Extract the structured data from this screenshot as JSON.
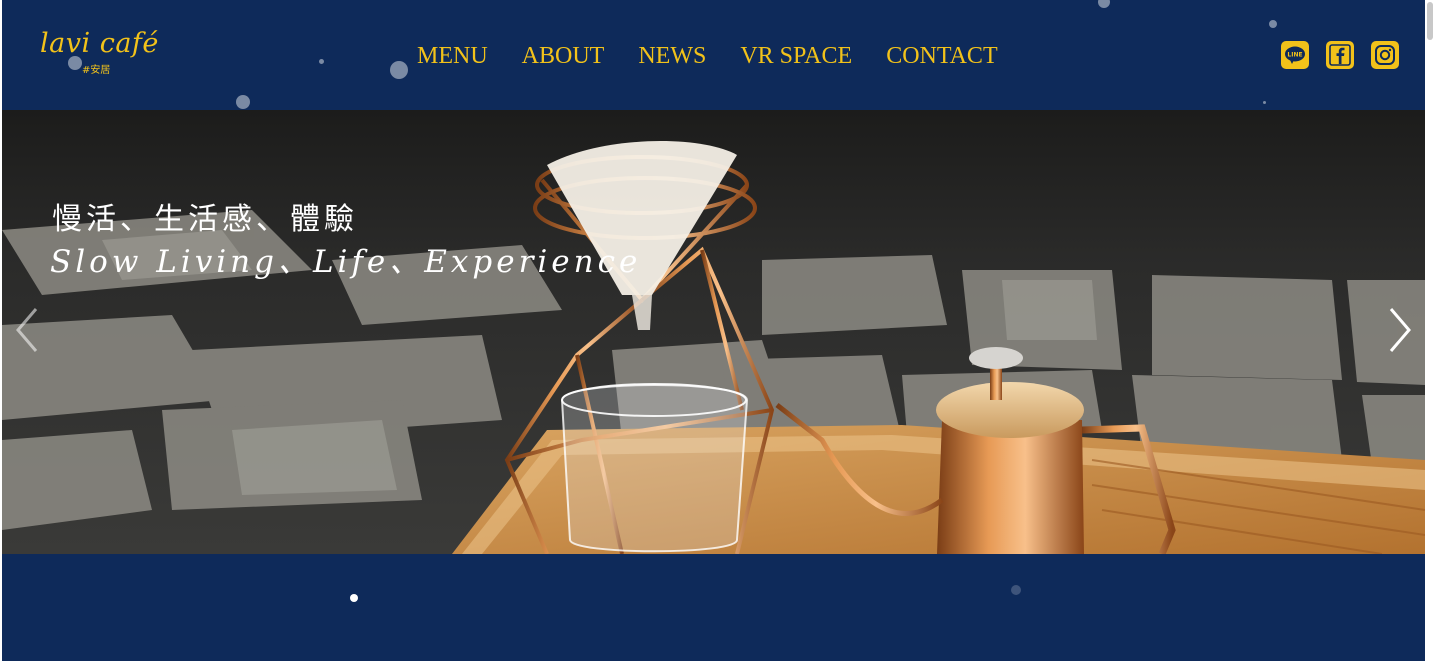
{
  "brand": {
    "logo_text": "lavi café",
    "logo_sub": "#安居",
    "color_primary": "#0e2a5a",
    "color_accent": "#f2c21a"
  },
  "nav": {
    "items": [
      {
        "label": "MENU"
      },
      {
        "label": "ABOUT"
      },
      {
        "label": "NEWS"
      },
      {
        "label": "VR SPACE"
      },
      {
        "label": "CONTACT"
      }
    ]
  },
  "social": {
    "icons": [
      "line-icon",
      "facebook-icon",
      "instagram-icon"
    ],
    "line_label": "LINE"
  },
  "hero": {
    "headline_zh": "慢活、生活感、體驗",
    "headline_en": "Slow Living、Life、Experience"
  },
  "carousel": {
    "prev_icon": "chevron-left-icon",
    "next_icon": "chevron-right-icon"
  }
}
